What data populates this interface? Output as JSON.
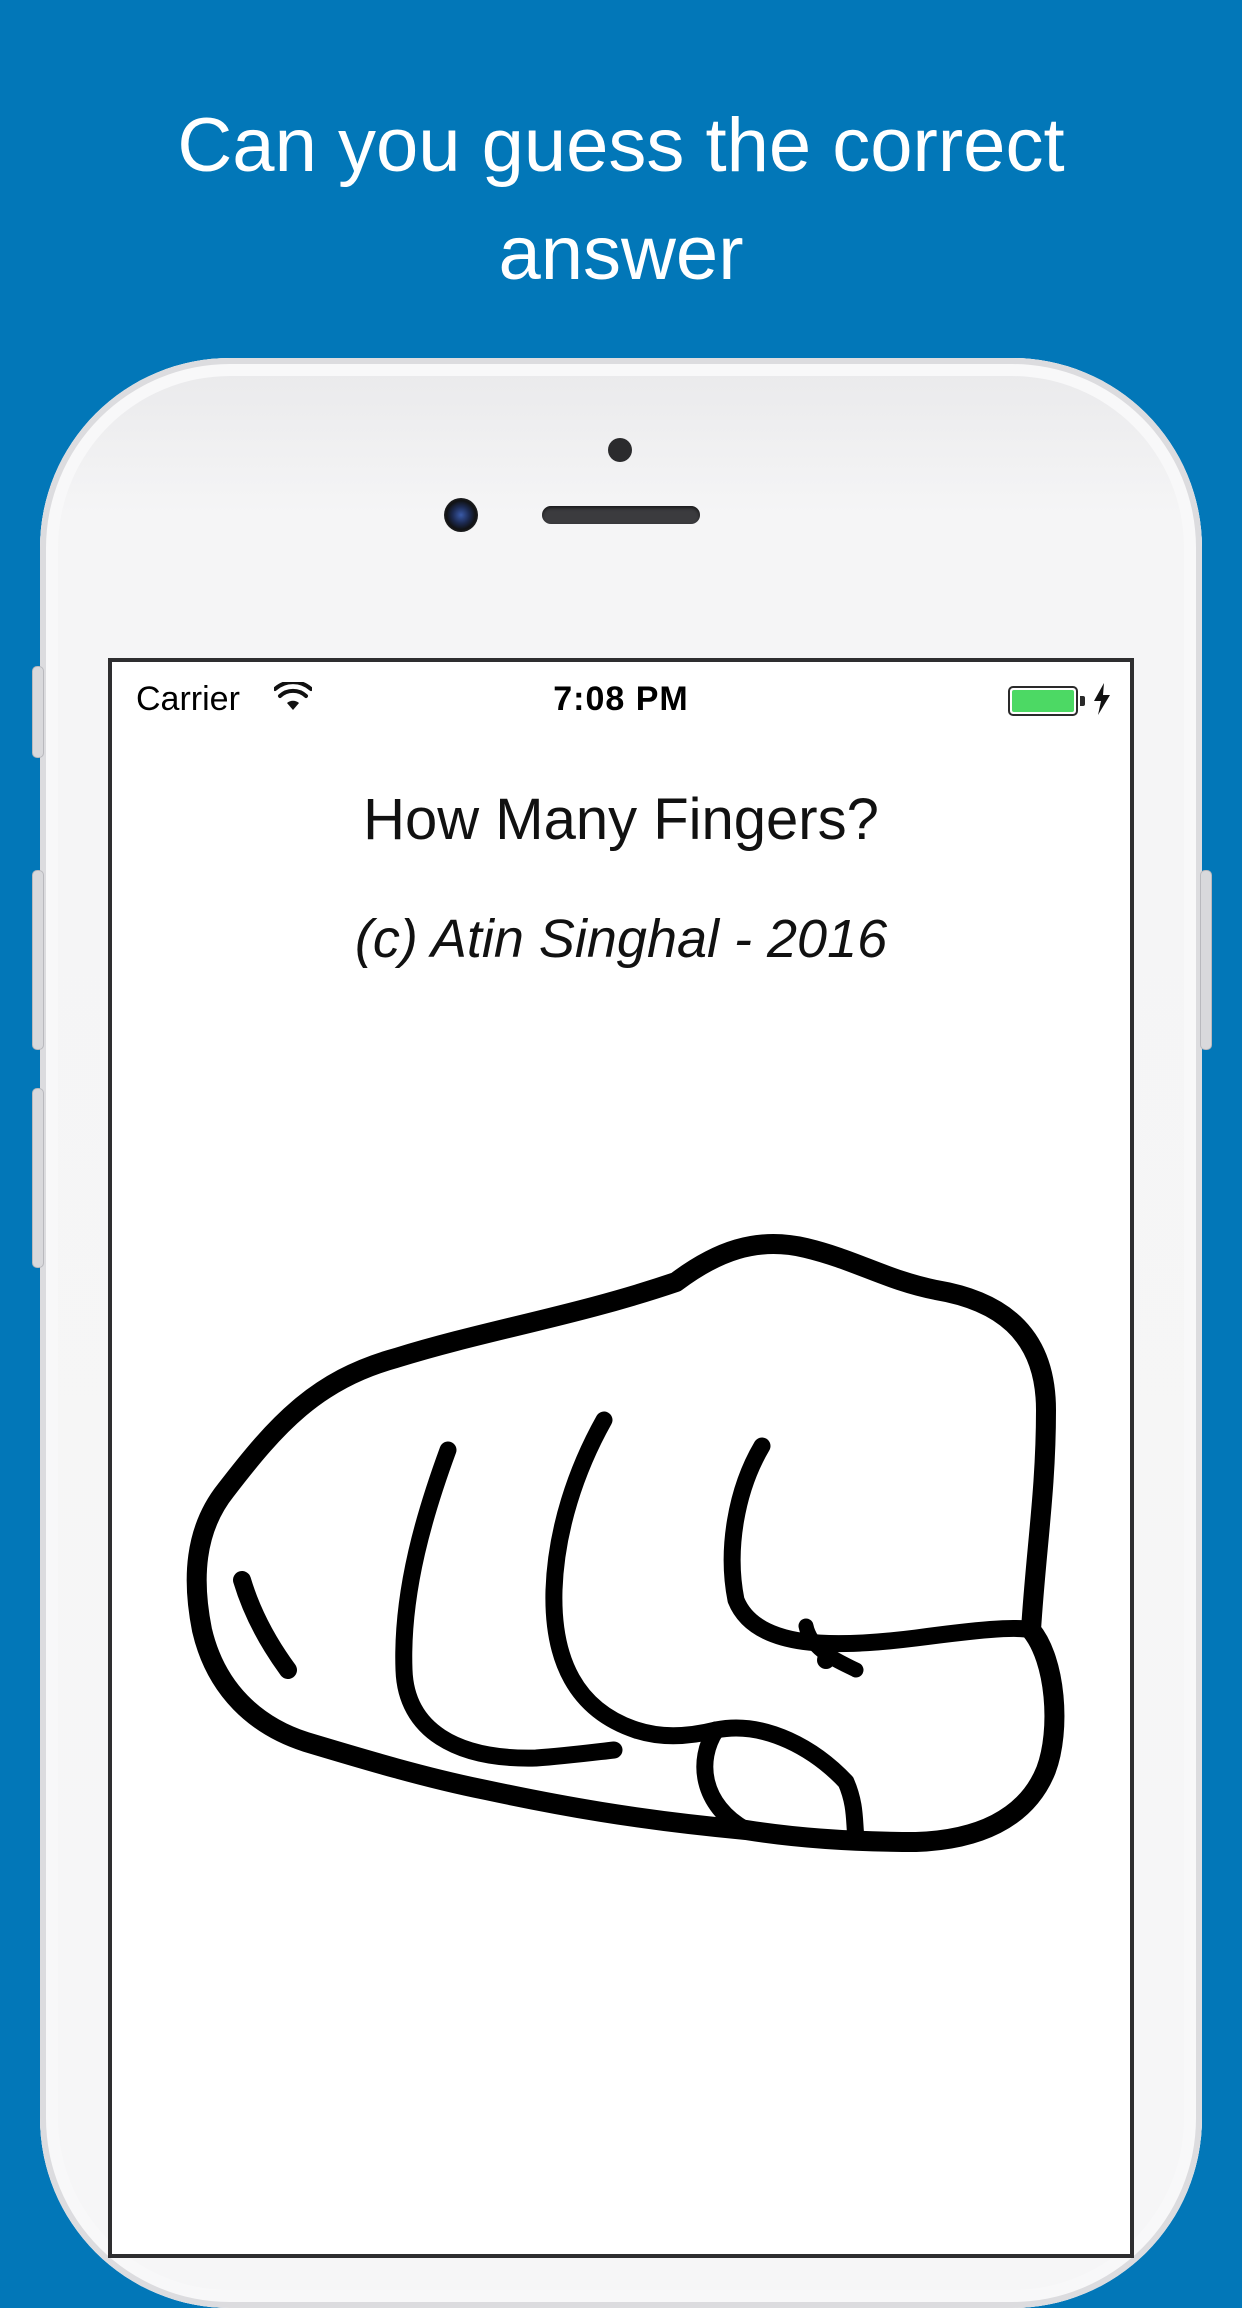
{
  "headline": {
    "line1": "Can you guess the correct",
    "line2": "answer"
  },
  "status_bar": {
    "carrier": "Carrier",
    "time": "7:08 PM",
    "battery_level": 1.0,
    "charging": true,
    "icons": [
      "wifi-icon",
      "battery-icon",
      "charging-bolt-icon"
    ]
  },
  "app": {
    "title": "How Many Fingers?",
    "copyright": "(c) Atin Singhal - 2016",
    "image": "closed-fist-drawing"
  },
  "colors": {
    "background": "#0277b8",
    "headline_text": "#ffffff",
    "battery_fill": "#4cd964",
    "phone_body": "#f5f5f6"
  }
}
